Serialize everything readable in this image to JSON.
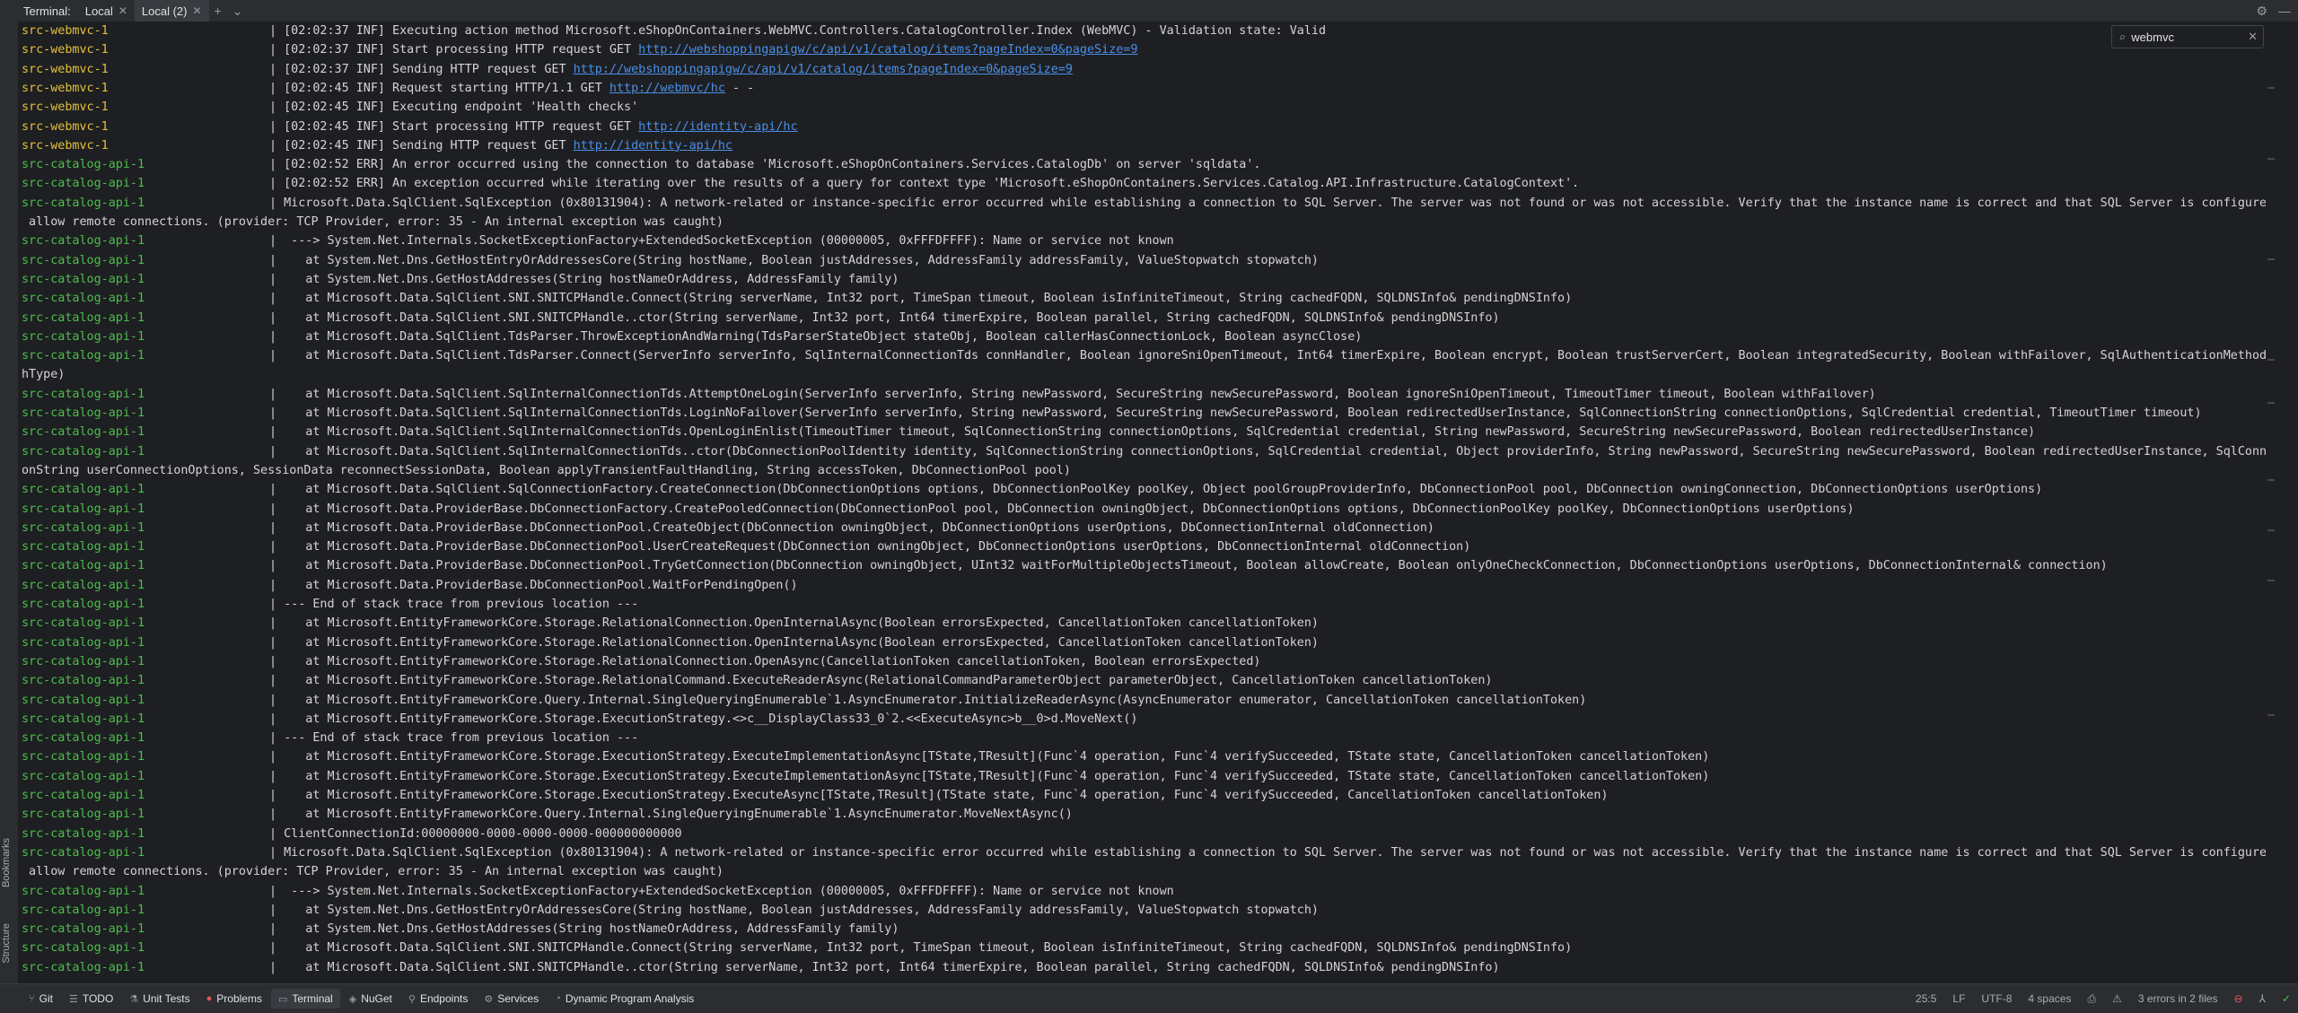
{
  "topbar": {
    "title": "Terminal:",
    "tabs": [
      {
        "label": "Local"
      },
      {
        "label": "Local (2)"
      }
    ]
  },
  "search": {
    "value": "webmvc"
  },
  "sidebar": {
    "bookmarks": "Bookmarks",
    "structure": "Structure"
  },
  "colors": {
    "webmvc": "#e2c03a",
    "catalog": "#4dbd4d",
    "link": "#4a8fe7"
  },
  "terminal": {
    "lines": [
      {
        "svc": "src-webmvc-1",
        "sep": "| ",
        "pre": "[02:02:37 INF] Executing action method Microsoft.eShopOnContainers.WebMVC.Controllers.CatalogController.Index (WebMVC) - Validation state: Valid",
        "link": "",
        "post": ""
      },
      {
        "svc": "src-webmvc-1",
        "sep": "| ",
        "pre": "[02:02:37 INF] Start processing HTTP request GET ",
        "link": "http://webshoppingapigw/c/api/v1/catalog/items?pageIndex=0&pageSize=9",
        "post": ""
      },
      {
        "svc": "src-webmvc-1",
        "sep": "| ",
        "pre": "[02:02:37 INF] Sending HTTP request GET ",
        "link": "http://webshoppingapigw/c/api/v1/catalog/items?pageIndex=0&pageSize=9",
        "post": ""
      },
      {
        "svc": "src-webmvc-1",
        "sep": "| ",
        "pre": "[02:02:45 INF] Request starting HTTP/1.1 GET ",
        "link": "http://webmvc/hc",
        "post": " - -"
      },
      {
        "svc": "src-webmvc-1",
        "sep": "| ",
        "pre": "[02:02:45 INF] Executing endpoint 'Health checks'",
        "link": "",
        "post": ""
      },
      {
        "svc": "src-webmvc-1",
        "sep": "| ",
        "pre": "[02:02:45 INF] Start processing HTTP request GET ",
        "link": "http://identity-api/hc",
        "post": ""
      },
      {
        "svc": "src-webmvc-1",
        "sep": "| ",
        "pre": "[02:02:45 INF] Sending HTTP request GET ",
        "link": "http://identity-api/hc",
        "post": ""
      },
      {
        "svc": "src-catalog-api-1",
        "sep": "| ",
        "pre": "[02:02:52 ERR] An error occurred using the connection to database 'Microsoft.eShopOnContainers.Services.CatalogDb' on server 'sqldata'.",
        "link": "",
        "post": ""
      },
      {
        "svc": "src-catalog-api-1",
        "sep": "| ",
        "pre": "[02:02:52 ERR] An exception occurred while iterating over the results of a query for context type 'Microsoft.eShopOnContainers.Services.Catalog.API.Infrastructure.CatalogContext'.",
        "link": "",
        "post": ""
      },
      {
        "svc": "src-catalog-api-1",
        "sep": "| ",
        "pre": "Microsoft.Data.SqlClient.SqlException (0x80131904): A network-related or instance-specific error occurred while establishing a connection to SQL Server. The server was not found or was not accessible. Verify that the instance name is correct and that SQL Server is configured to",
        "link": "",
        "post": ""
      },
      {
        "svc": "",
        "sep": "",
        "pre": " allow remote connections. (provider: TCP Provider, error: 35 - An internal exception was caught)",
        "link": "",
        "post": ""
      },
      {
        "svc": "src-catalog-api-1",
        "sep": "| ",
        "pre": " ---> System.Net.Internals.SocketExceptionFactory+ExtendedSocketException (00000005, 0xFFFDFFFF): Name or service not known",
        "link": "",
        "post": ""
      },
      {
        "svc": "src-catalog-api-1",
        "sep": "| ",
        "pre": "   at System.Net.Dns.GetHostEntryOrAddressesCore(String hostName, Boolean justAddresses, AddressFamily addressFamily, ValueStopwatch stopwatch)",
        "link": "",
        "post": ""
      },
      {
        "svc": "src-catalog-api-1",
        "sep": "| ",
        "pre": "   at System.Net.Dns.GetHostAddresses(String hostNameOrAddress, AddressFamily family)",
        "link": "",
        "post": ""
      },
      {
        "svc": "src-catalog-api-1",
        "sep": "| ",
        "pre": "   at Microsoft.Data.SqlClient.SNI.SNITCPHandle.Connect(String serverName, Int32 port, TimeSpan timeout, Boolean isInfiniteTimeout, String cachedFQDN, SQLDNSInfo& pendingDNSInfo)",
        "link": "",
        "post": ""
      },
      {
        "svc": "src-catalog-api-1",
        "sep": "| ",
        "pre": "   at Microsoft.Data.SqlClient.SNI.SNITCPHandle..ctor(String serverName, Int32 port, Int64 timerExpire, Boolean parallel, String cachedFQDN, SQLDNSInfo& pendingDNSInfo)",
        "link": "",
        "post": ""
      },
      {
        "svc": "src-catalog-api-1",
        "sep": "| ",
        "pre": "   at Microsoft.Data.SqlClient.TdsParser.ThrowExceptionAndWarning(TdsParserStateObject stateObj, Boolean callerHasConnectionLock, Boolean asyncClose)",
        "link": "",
        "post": ""
      },
      {
        "svc": "src-catalog-api-1",
        "sep": "| ",
        "pre": "   at Microsoft.Data.SqlClient.TdsParser.Connect(ServerInfo serverInfo, SqlInternalConnectionTds connHandler, Boolean ignoreSniOpenTimeout, Int64 timerExpire, Boolean encrypt, Boolean trustServerCert, Boolean integratedSecurity, Boolean withFailover, SqlAuthenticationMethod aut",
        "link": "",
        "post": ""
      },
      {
        "svc": "",
        "sep": "",
        "pre": "hType)",
        "link": "",
        "post": ""
      },
      {
        "svc": "src-catalog-api-1",
        "sep": "| ",
        "pre": "   at Microsoft.Data.SqlClient.SqlInternalConnectionTds.AttemptOneLogin(ServerInfo serverInfo, String newPassword, SecureString newSecurePassword, Boolean ignoreSniOpenTimeout, TimeoutTimer timeout, Boolean withFailover)",
        "link": "",
        "post": ""
      },
      {
        "svc": "src-catalog-api-1",
        "sep": "| ",
        "pre": "   at Microsoft.Data.SqlClient.SqlInternalConnectionTds.LoginNoFailover(ServerInfo serverInfo, String newPassword, SecureString newSecurePassword, Boolean redirectedUserInstance, SqlConnectionString connectionOptions, SqlCredential credential, TimeoutTimer timeout)",
        "link": "",
        "post": ""
      },
      {
        "svc": "src-catalog-api-1",
        "sep": "| ",
        "pre": "   at Microsoft.Data.SqlClient.SqlInternalConnectionTds.OpenLoginEnlist(TimeoutTimer timeout, SqlConnectionString connectionOptions, SqlCredential credential, String newPassword, SecureString newSecurePassword, Boolean redirectedUserInstance)",
        "link": "",
        "post": ""
      },
      {
        "svc": "src-catalog-api-1",
        "sep": "| ",
        "pre": "   at Microsoft.Data.SqlClient.SqlInternalConnectionTds..ctor(DbConnectionPoolIdentity identity, SqlConnectionString connectionOptions, SqlCredential credential, Object providerInfo, String newPassword, SecureString newSecurePassword, Boolean redirectedUserInstance, SqlConnecti",
        "link": "",
        "post": ""
      },
      {
        "svc": "",
        "sep": "",
        "pre": "onString userConnectionOptions, SessionData reconnectSessionData, Boolean applyTransientFaultHandling, String accessToken, DbConnectionPool pool)",
        "link": "",
        "post": ""
      },
      {
        "svc": "src-catalog-api-1",
        "sep": "| ",
        "pre": "   at Microsoft.Data.SqlClient.SqlConnectionFactory.CreateConnection(DbConnectionOptions options, DbConnectionPoolKey poolKey, Object poolGroupProviderInfo, DbConnectionPool pool, DbConnection owningConnection, DbConnectionOptions userOptions)",
        "link": "",
        "post": ""
      },
      {
        "svc": "src-catalog-api-1",
        "sep": "| ",
        "pre": "   at Microsoft.Data.ProviderBase.DbConnectionFactory.CreatePooledConnection(DbConnectionPool pool, DbConnection owningObject, DbConnectionOptions options, DbConnectionPoolKey poolKey, DbConnectionOptions userOptions)",
        "link": "",
        "post": ""
      },
      {
        "svc": "src-catalog-api-1",
        "sep": "| ",
        "pre": "   at Microsoft.Data.ProviderBase.DbConnectionPool.CreateObject(DbConnection owningObject, DbConnectionOptions userOptions, DbConnectionInternal oldConnection)",
        "link": "",
        "post": ""
      },
      {
        "svc": "src-catalog-api-1",
        "sep": "| ",
        "pre": "   at Microsoft.Data.ProviderBase.DbConnectionPool.UserCreateRequest(DbConnection owningObject, DbConnectionOptions userOptions, DbConnectionInternal oldConnection)",
        "link": "",
        "post": ""
      },
      {
        "svc": "src-catalog-api-1",
        "sep": "| ",
        "pre": "   at Microsoft.Data.ProviderBase.DbConnectionPool.TryGetConnection(DbConnection owningObject, UInt32 waitForMultipleObjectsTimeout, Boolean allowCreate, Boolean onlyOneCheckConnection, DbConnectionOptions userOptions, DbConnectionInternal& connection)",
        "link": "",
        "post": ""
      },
      {
        "svc": "src-catalog-api-1",
        "sep": "| ",
        "pre": "   at Microsoft.Data.ProviderBase.DbConnectionPool.WaitForPendingOpen()",
        "link": "",
        "post": ""
      },
      {
        "svc": "src-catalog-api-1",
        "sep": "| ",
        "pre": "--- End of stack trace from previous location ---",
        "link": "",
        "post": ""
      },
      {
        "svc": "src-catalog-api-1",
        "sep": "| ",
        "pre": "   at Microsoft.EntityFrameworkCore.Storage.RelationalConnection.OpenInternalAsync(Boolean errorsExpected, CancellationToken cancellationToken)",
        "link": "",
        "post": ""
      },
      {
        "svc": "src-catalog-api-1",
        "sep": "| ",
        "pre": "   at Microsoft.EntityFrameworkCore.Storage.RelationalConnection.OpenInternalAsync(Boolean errorsExpected, CancellationToken cancellationToken)",
        "link": "",
        "post": ""
      },
      {
        "svc": "src-catalog-api-1",
        "sep": "| ",
        "pre": "   at Microsoft.EntityFrameworkCore.Storage.RelationalConnection.OpenAsync(CancellationToken cancellationToken, Boolean errorsExpected)",
        "link": "",
        "post": ""
      },
      {
        "svc": "src-catalog-api-1",
        "sep": "| ",
        "pre": "   at Microsoft.EntityFrameworkCore.Storage.RelationalCommand.ExecuteReaderAsync(RelationalCommandParameterObject parameterObject, CancellationToken cancellationToken)",
        "link": "",
        "post": ""
      },
      {
        "svc": "src-catalog-api-1",
        "sep": "| ",
        "pre": "   at Microsoft.EntityFrameworkCore.Query.Internal.SingleQueryingEnumerable`1.AsyncEnumerator.InitializeReaderAsync(AsyncEnumerator enumerator, CancellationToken cancellationToken)",
        "link": "",
        "post": ""
      },
      {
        "svc": "src-catalog-api-1",
        "sep": "| ",
        "pre": "   at Microsoft.EntityFrameworkCore.Storage.ExecutionStrategy.<>c__DisplayClass33_0`2.<<ExecuteAsync>b__0>d.MoveNext()",
        "link": "",
        "post": ""
      },
      {
        "svc": "src-catalog-api-1",
        "sep": "| ",
        "pre": "--- End of stack trace from previous location ---",
        "link": "",
        "post": ""
      },
      {
        "svc": "src-catalog-api-1",
        "sep": "| ",
        "pre": "   at Microsoft.EntityFrameworkCore.Storage.ExecutionStrategy.ExecuteImplementationAsync[TState,TResult](Func`4 operation, Func`4 verifySucceeded, TState state, CancellationToken cancellationToken)",
        "link": "",
        "post": ""
      },
      {
        "svc": "src-catalog-api-1",
        "sep": "| ",
        "pre": "   at Microsoft.EntityFrameworkCore.Storage.ExecutionStrategy.ExecuteImplementationAsync[TState,TResult](Func`4 operation, Func`4 verifySucceeded, TState state, CancellationToken cancellationToken)",
        "link": "",
        "post": ""
      },
      {
        "svc": "src-catalog-api-1",
        "sep": "| ",
        "pre": "   at Microsoft.EntityFrameworkCore.Storage.ExecutionStrategy.ExecuteAsync[TState,TResult](TState state, Func`4 operation, Func`4 verifySucceeded, CancellationToken cancellationToken)",
        "link": "",
        "post": ""
      },
      {
        "svc": "src-catalog-api-1",
        "sep": "| ",
        "pre": "   at Microsoft.EntityFrameworkCore.Query.Internal.SingleQueryingEnumerable`1.AsyncEnumerator.MoveNextAsync()",
        "link": "",
        "post": ""
      },
      {
        "svc": "src-catalog-api-1",
        "sep": "| ",
        "pre": "ClientConnectionId:00000000-0000-0000-0000-000000000000",
        "link": "",
        "post": ""
      },
      {
        "svc": "src-catalog-api-1",
        "sep": "| ",
        "pre": "Microsoft.Data.SqlClient.SqlException (0x80131904): A network-related or instance-specific error occurred while establishing a connection to SQL Server. The server was not found or was not accessible. Verify that the instance name is correct and that SQL Server is configured to",
        "link": "",
        "post": ""
      },
      {
        "svc": "",
        "sep": "",
        "pre": " allow remote connections. (provider: TCP Provider, error: 35 - An internal exception was caught)",
        "link": "",
        "post": ""
      },
      {
        "svc": "src-catalog-api-1",
        "sep": "| ",
        "pre": " ---> System.Net.Internals.SocketExceptionFactory+ExtendedSocketException (00000005, 0xFFFDFFFF): Name or service not known",
        "link": "",
        "post": ""
      },
      {
        "svc": "src-catalog-api-1",
        "sep": "| ",
        "pre": "   at System.Net.Dns.GetHostEntryOrAddressesCore(String hostName, Boolean justAddresses, AddressFamily addressFamily, ValueStopwatch stopwatch)",
        "link": "",
        "post": ""
      },
      {
        "svc": "src-catalog-api-1",
        "sep": "| ",
        "pre": "   at System.Net.Dns.GetHostAddresses(String hostNameOrAddress, AddressFamily family)",
        "link": "",
        "post": ""
      },
      {
        "svc": "src-catalog-api-1",
        "sep": "| ",
        "pre": "   at Microsoft.Data.SqlClient.SNI.SNITCPHandle.Connect(String serverName, Int32 port, TimeSpan timeout, Boolean isInfiniteTimeout, String cachedFQDN, SQLDNSInfo& pendingDNSInfo)",
        "link": "",
        "post": ""
      },
      {
        "svc": "src-catalog-api-1",
        "sep": "| ",
        "pre": "   at Microsoft.Data.SqlClient.SNI.SNITCPHandle..ctor(String serverName, Int32 port, Int64 timerExpire, Boolean parallel, String cachedFQDN, SQLDNSInfo& pendingDNSInfo)",
        "link": "",
        "post": ""
      }
    ]
  },
  "bottombar": {
    "tools": [
      {
        "label": "Git",
        "icon": "branch-icon"
      },
      {
        "label": "TODO",
        "icon": "list-icon"
      },
      {
        "label": "Unit Tests",
        "icon": "test-icon"
      },
      {
        "label": "Problems",
        "icon": "error-icon"
      },
      {
        "label": "Terminal",
        "icon": "terminal-icon"
      },
      {
        "label": "NuGet",
        "icon": "nuget-icon"
      },
      {
        "label": "Endpoints",
        "icon": "endpoints-icon"
      },
      {
        "label": "Services",
        "icon": "services-icon"
      },
      {
        "label": "Dynamic Program Analysis",
        "icon": "analysis-icon"
      }
    ],
    "status": {
      "position": "25:5",
      "line_ending": "LF",
      "encoding": "UTF-8",
      "indent": "4 spaces",
      "errors": "3 errors in 2 files"
    }
  }
}
